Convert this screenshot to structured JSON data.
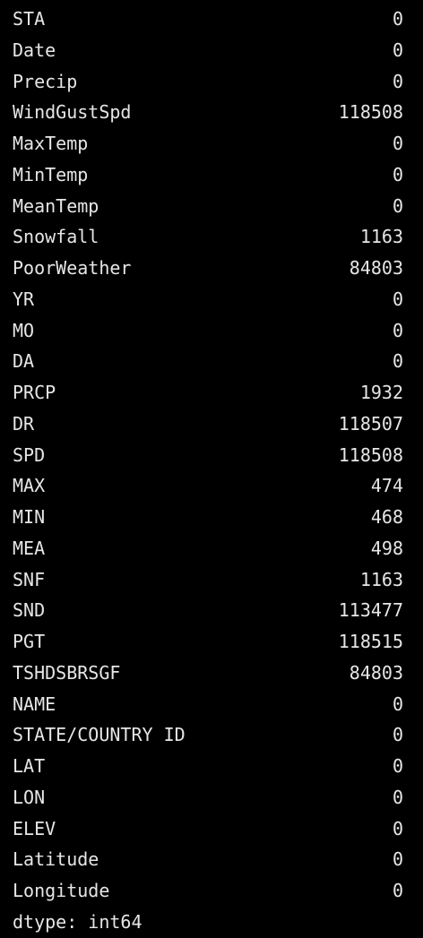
{
  "output": {
    "rows": [
      {
        "key": "STA",
        "value": "0"
      },
      {
        "key": "Date",
        "value": "0"
      },
      {
        "key": "Precip",
        "value": "0"
      },
      {
        "key": "WindGustSpd",
        "value": "118508"
      },
      {
        "key": "MaxTemp",
        "value": "0"
      },
      {
        "key": "MinTemp",
        "value": "0"
      },
      {
        "key": "MeanTemp",
        "value": "0"
      },
      {
        "key": "Snowfall",
        "value": "1163"
      },
      {
        "key": "PoorWeather",
        "value": "84803"
      },
      {
        "key": "YR",
        "value": "0"
      },
      {
        "key": "MO",
        "value": "0"
      },
      {
        "key": "DA",
        "value": "0"
      },
      {
        "key": "PRCP",
        "value": "1932"
      },
      {
        "key": "DR",
        "value": "118507"
      },
      {
        "key": "SPD",
        "value": "118508"
      },
      {
        "key": "MAX",
        "value": "474"
      },
      {
        "key": "MIN",
        "value": "468"
      },
      {
        "key": "MEA",
        "value": "498"
      },
      {
        "key": "SNF",
        "value": "1163"
      },
      {
        "key": "SND",
        "value": "113477"
      },
      {
        "key": "PGT",
        "value": "118515"
      },
      {
        "key": "TSHDSBRSGF",
        "value": "84803"
      },
      {
        "key": "NAME",
        "value": "0"
      },
      {
        "key": "STATE/COUNTRY ID",
        "value": "0"
      },
      {
        "key": "LAT",
        "value": "0"
      },
      {
        "key": "LON",
        "value": "0"
      },
      {
        "key": "ELEV",
        "value": "0"
      },
      {
        "key": "Latitude",
        "value": "0"
      },
      {
        "key": "Longitude",
        "value": "0"
      }
    ],
    "dtype": "dtype: int64"
  },
  "colors": {
    "background": "#000000",
    "text": "#e6e6e6"
  }
}
